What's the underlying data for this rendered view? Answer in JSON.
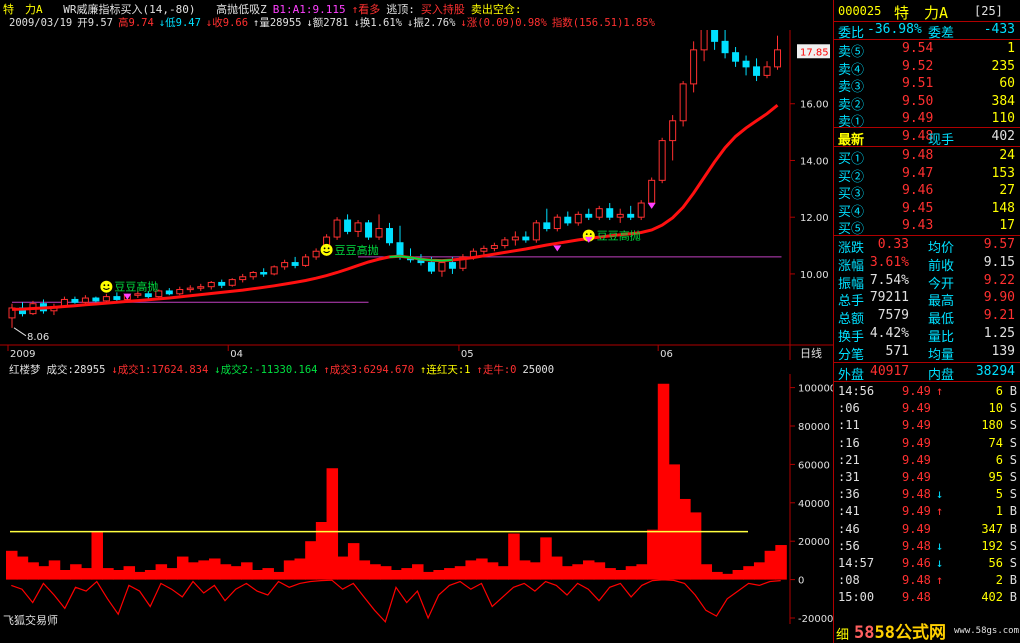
{
  "header": {
    "stock_name": "特　力A",
    "indicator_name": "WR威廉指标买入(14,-80)",
    "line1_rest": [
      {
        "text": "高抛低吸Z",
        "color": "#e0e0e0"
      },
      {
        "text": "B1:A1:9.115",
        "color": "#ff40ff"
      },
      {
        "text": "↑看多",
        "color": "#ff3030"
      },
      {
        "text": "逃顶:",
        "color": "#e0e0e0"
      },
      {
        "text": "买入持股",
        "color": "#ff3030"
      },
      {
        "text": "卖出空仓:",
        "color": "#ffff00"
      }
    ],
    "line2": [
      {
        "text": "2009/03/19",
        "color": "#e0e0e0"
      },
      {
        "text": "开9.57",
        "color": "#e0e0e0"
      },
      {
        "text": "高9.74",
        "color": "#ff3030"
      },
      {
        "text": "↓低9.47",
        "color": "#00e0ff"
      },
      {
        "text": "↓收9.66",
        "color": "#ff3030"
      },
      {
        "text": "↑量28955",
        "color": "#e0e0e0"
      },
      {
        "text": "↓额2781",
        "color": "#e0e0e0"
      },
      {
        "text": "↓换1.61%",
        "color": "#e0e0e0"
      },
      {
        "text": "↓振2.76%",
        "color": "#e0e0e0"
      },
      {
        "text": "↓涨(0.09)0.98%",
        "color": "#ff3030"
      },
      {
        "text": "指数(156.51)1.85%",
        "color": "#ff3030"
      }
    ]
  },
  "price_axis": {
    "labels": [
      "16.00",
      "14.00",
      "12.00",
      "10.00"
    ],
    "current_price_tag": "17.85",
    "min_price_label": "8.06",
    "period_label": "日线"
  },
  "date_axis": {
    "labels": [
      "2009",
      "04",
      "05",
      "06"
    ]
  },
  "annotations": {
    "smiley_label": "豆豆高抛"
  },
  "volume_header": [
    {
      "text": "红楼梦",
      "color": "#e0e0e0"
    },
    {
      "text": "成交:28955",
      "color": "#e0e0e0"
    },
    {
      "text": "↓成交1:17624.834",
      "color": "#ff3030"
    },
    {
      "text": "↓成交2:-11330.164",
      "color": "#00e040"
    },
    {
      "text": "↑成交3:6294.670",
      "color": "#ff3030"
    },
    {
      "text": "↑连红天:1",
      "color": "#ffff00"
    },
    {
      "text": "↑走牛:0",
      "color": "#ff3030"
    },
    {
      "text": "25000",
      "color": "#e0e0e0"
    }
  ],
  "volume_axis": {
    "labels": [
      "100000",
      "80000",
      "60000",
      "40000",
      "20000",
      "0",
      "-20000"
    ]
  },
  "footer": {
    "software_name": "飞狐交易师",
    "watermark": "58公式网",
    "watermark_url": "www.58gs.com",
    "bottom_tab": "细"
  },
  "quote": {
    "code": "000025",
    "name": "特　力A",
    "count": "[25]",
    "weibi_label": "委比",
    "weibi_value": "-36.98%",
    "weicha_label": "委差",
    "weicha_value": "-433",
    "sell": [
      {
        "label": "卖⑤",
        "price": "9.54",
        "vol": "1"
      },
      {
        "label": "卖④",
        "price": "9.52",
        "vol": "235"
      },
      {
        "label": "卖③",
        "price": "9.51",
        "vol": "60"
      },
      {
        "label": "卖②",
        "price": "9.50",
        "vol": "384"
      },
      {
        "label": "卖①",
        "price": "9.49",
        "vol": "110"
      }
    ],
    "latest": {
      "label": "最新",
      "price": "9.48",
      "hand_label": "现手",
      "hand": "402"
    },
    "buy": [
      {
        "label": "买①",
        "price": "9.48",
        "vol": "24"
      },
      {
        "label": "买②",
        "price": "9.47",
        "vol": "153"
      },
      {
        "label": "买③",
        "price": "9.46",
        "vol": "27"
      },
      {
        "label": "买④",
        "price": "9.45",
        "vol": "148"
      },
      {
        "label": "买⑤",
        "price": "9.43",
        "vol": "17"
      }
    ],
    "stats": [
      {
        "l1": "涨跌",
        "v1": "0.33",
        "c1": "#ff3030",
        "l2": "均价",
        "v2": "9.57",
        "c2": "#ff3030"
      },
      {
        "l1": "涨幅",
        "v1": "3.61%",
        "c1": "#ff3030",
        "l2": "前收",
        "v2": "9.15",
        "c2": "#e0e0e0"
      },
      {
        "l1": "振幅",
        "v1": "7.54%",
        "c1": "#e0e0e0",
        "l2": "今开",
        "v2": "9.22",
        "c2": "#ff3030"
      },
      {
        "l1": "总手",
        "v1": "79211",
        "c1": "#e0e0e0",
        "l2": "最高",
        "v2": "9.90",
        "c2": "#ff3030"
      },
      {
        "l1": "总额",
        "v1": "7579",
        "c1": "#e0e0e0",
        "l2": "最低",
        "v2": "9.21",
        "c2": "#ff3030"
      },
      {
        "l1": "换手",
        "v1": "4.42%",
        "c1": "#e0e0e0",
        "l2": "量比",
        "v2": "1.25",
        "c2": "#e0e0e0"
      },
      {
        "l1": "分笔",
        "v1": "571",
        "c1": "#e0e0e0",
        "l2": "均量",
        "v2": "139",
        "c2": "#e0e0e0"
      }
    ],
    "outer_label": "外盘",
    "outer_value": "40917",
    "inner_label": "内盘",
    "inner_value": "38294",
    "ticks": [
      {
        "time": "14:56",
        "price": "9.49",
        "arrow": "↑",
        "vol": "6",
        "side": "B"
      },
      {
        "time": ":06",
        "price": "9.49",
        "arrow": "",
        "vol": "10",
        "side": "S"
      },
      {
        "time": ":11",
        "price": "9.49",
        "arrow": "",
        "vol": "180",
        "side": "S"
      },
      {
        "time": ":16",
        "price": "9.49",
        "arrow": "",
        "vol": "74",
        "side": "S"
      },
      {
        "time": ":21",
        "price": "9.49",
        "arrow": "",
        "vol": "6",
        "side": "S"
      },
      {
        "time": ":31",
        "price": "9.49",
        "arrow": "",
        "vol": "95",
        "side": "S"
      },
      {
        "time": ":36",
        "price": "9.48",
        "arrow": "↓",
        "vol": "5",
        "side": "S"
      },
      {
        "time": ":41",
        "price": "9.49",
        "arrow": "↑",
        "vol": "1",
        "side": "B"
      },
      {
        "time": ":46",
        "price": "9.49",
        "arrow": "",
        "vol": "347",
        "side": "B"
      },
      {
        "time": ":56",
        "price": "9.48",
        "arrow": "↓",
        "vol": "192",
        "side": "S"
      },
      {
        "time": "14:57",
        "price": "9.46",
        "arrow": "↓",
        "vol": "56",
        "side": "S"
      },
      {
        "time": ":08",
        "price": "9.48",
        "arrow": "↑",
        "vol": "2",
        "side": "B"
      },
      {
        "time": "15:00",
        "price": "9.48",
        "arrow": "",
        "vol": "402",
        "side": "B"
      }
    ]
  },
  "colors": {
    "up": "#ff3030",
    "down": "#00e0ff",
    "label": "#ffff00",
    "ma": "#ff1010",
    "border": "#b00000",
    "refline": "#c040c0"
  },
  "chart_data": [
    {
      "type": "candlestick",
      "title": "",
      "price_axis_ticks": [
        10,
        12,
        14,
        16
      ],
      "ylim": [
        7.6,
        18.6
      ],
      "x_labels": [
        "2009",
        "04",
        "05",
        "06"
      ],
      "ohlc": [
        {
          "o": 8.45,
          "h": 8.95,
          "l": 8.1,
          "c": 8.8
        },
        {
          "o": 8.8,
          "h": 9.0,
          "l": 8.5,
          "c": 8.6
        },
        {
          "o": 8.6,
          "h": 9.05,
          "l": 8.55,
          "c": 8.95
        },
        {
          "o": 8.95,
          "h": 9.1,
          "l": 8.6,
          "c": 8.7
        },
        {
          "o": 8.7,
          "h": 8.95,
          "l": 8.55,
          "c": 8.85
        },
        {
          "o": 8.85,
          "h": 9.2,
          "l": 8.8,
          "c": 9.1
        },
        {
          "o": 9.1,
          "h": 9.2,
          "l": 8.95,
          "c": 9.0
        },
        {
          "o": 9.0,
          "h": 9.25,
          "l": 8.95,
          "c": 9.15
        },
        {
          "o": 9.15,
          "h": 9.2,
          "l": 8.95,
          "c": 9.05
        },
        {
          "o": 9.05,
          "h": 9.3,
          "l": 9.0,
          "c": 9.2
        },
        {
          "o": 9.2,
          "h": 9.35,
          "l": 9.05,
          "c": 9.1
        },
        {
          "o": 9.1,
          "h": 9.3,
          "l": 9.05,
          "c": 9.25
        },
        {
          "o": 9.25,
          "h": 9.4,
          "l": 9.15,
          "c": 9.3
        },
        {
          "o": 9.3,
          "h": 9.4,
          "l": 9.1,
          "c": 9.2
        },
        {
          "o": 9.2,
          "h": 9.45,
          "l": 9.15,
          "c": 9.4
        },
        {
          "o": 9.4,
          "h": 9.5,
          "l": 9.25,
          "c": 9.3
        },
        {
          "o": 9.3,
          "h": 9.55,
          "l": 9.25,
          "c": 9.45
        },
        {
          "o": 9.45,
          "h": 9.6,
          "l": 9.35,
          "c": 9.5
        },
        {
          "o": 9.5,
          "h": 9.65,
          "l": 9.4,
          "c": 9.55
        },
        {
          "o": 9.55,
          "h": 9.75,
          "l": 9.45,
          "c": 9.7
        },
        {
          "o": 9.7,
          "h": 9.8,
          "l": 9.5,
          "c": 9.6
        },
        {
          "o": 9.6,
          "h": 9.85,
          "l": 9.55,
          "c": 9.8
        },
        {
          "o": 9.8,
          "h": 10.0,
          "l": 9.7,
          "c": 9.9
        },
        {
          "o": 9.9,
          "h": 10.1,
          "l": 9.8,
          "c": 10.05
        },
        {
          "o": 10.05,
          "h": 10.2,
          "l": 9.9,
          "c": 10.0
        },
        {
          "o": 10.0,
          "h": 10.3,
          "l": 9.95,
          "c": 10.25
        },
        {
          "o": 10.25,
          "h": 10.5,
          "l": 10.15,
          "c": 10.4
        },
        {
          "o": 10.4,
          "h": 10.6,
          "l": 10.2,
          "c": 10.3
        },
        {
          "o": 10.3,
          "h": 10.7,
          "l": 10.25,
          "c": 10.6
        },
        {
          "o": 10.6,
          "h": 10.9,
          "l": 10.5,
          "c": 10.8
        },
        {
          "o": 10.8,
          "h": 11.4,
          "l": 10.7,
          "c": 11.3
        },
        {
          "o": 11.3,
          "h": 12.0,
          "l": 11.2,
          "c": 11.9
        },
        {
          "o": 11.9,
          "h": 12.1,
          "l": 11.4,
          "c": 11.5
        },
        {
          "o": 11.5,
          "h": 11.9,
          "l": 11.3,
          "c": 11.8
        },
        {
          "o": 11.8,
          "h": 11.9,
          "l": 11.2,
          "c": 11.3
        },
        {
          "o": 11.3,
          "h": 12.1,
          "l": 11.2,
          "c": 11.6
        },
        {
          "o": 11.6,
          "h": 11.8,
          "l": 11.0,
          "c": 11.1
        },
        {
          "o": 11.1,
          "h": 11.7,
          "l": 10.5,
          "c": 10.6
        },
        {
          "o": 10.6,
          "h": 10.9,
          "l": 10.4,
          "c": 10.5
        },
        {
          "o": 10.5,
          "h": 10.7,
          "l": 10.3,
          "c": 10.4
        },
        {
          "o": 10.4,
          "h": 10.6,
          "l": 10.0,
          "c": 10.1
        },
        {
          "o": 10.1,
          "h": 10.5,
          "l": 9.9,
          "c": 10.4
        },
        {
          "o": 10.4,
          "h": 10.6,
          "l": 10.0,
          "c": 10.2
        },
        {
          "o": 10.2,
          "h": 10.7,
          "l": 10.1,
          "c": 10.6
        },
        {
          "o": 10.6,
          "h": 10.9,
          "l": 10.5,
          "c": 10.8
        },
        {
          "o": 10.8,
          "h": 11.0,
          "l": 10.6,
          "c": 10.9
        },
        {
          "o": 10.9,
          "h": 11.1,
          "l": 10.8,
          "c": 11.0
        },
        {
          "o": 11.0,
          "h": 11.3,
          "l": 10.9,
          "c": 11.2
        },
        {
          "o": 11.2,
          "h": 11.5,
          "l": 11.0,
          "c": 11.3
        },
        {
          "o": 11.3,
          "h": 11.5,
          "l": 11.1,
          "c": 11.2
        },
        {
          "o": 11.2,
          "h": 11.9,
          "l": 11.1,
          "c": 11.8
        },
        {
          "o": 11.8,
          "h": 12.3,
          "l": 11.5,
          "c": 11.6
        },
        {
          "o": 11.6,
          "h": 12.1,
          "l": 11.5,
          "c": 12.0
        },
        {
          "o": 12.0,
          "h": 12.2,
          "l": 11.7,
          "c": 11.8
        },
        {
          "o": 11.8,
          "h": 12.2,
          "l": 11.7,
          "c": 12.1
        },
        {
          "o": 12.1,
          "h": 12.3,
          "l": 11.9,
          "c": 12.0
        },
        {
          "o": 12.0,
          "h": 12.4,
          "l": 11.9,
          "c": 12.3
        },
        {
          "o": 12.3,
          "h": 12.5,
          "l": 11.9,
          "c": 12.0
        },
        {
          "o": 12.0,
          "h": 12.3,
          "l": 11.8,
          "c": 12.1
        },
        {
          "o": 12.1,
          "h": 12.4,
          "l": 11.9,
          "c": 12.0
        },
        {
          "o": 12.0,
          "h": 12.6,
          "l": 11.9,
          "c": 12.5
        },
        {
          "o": 12.5,
          "h": 13.4,
          "l": 12.4,
          "c": 13.3
        },
        {
          "o": 13.3,
          "h": 14.8,
          "l": 13.2,
          "c": 14.7
        },
        {
          "o": 14.7,
          "h": 15.6,
          "l": 14.0,
          "c": 15.4
        },
        {
          "o": 15.4,
          "h": 16.8,
          "l": 15.2,
          "c": 16.7
        },
        {
          "o": 16.7,
          "h": 18.2,
          "l": 16.4,
          "c": 17.9
        },
        {
          "o": 17.9,
          "h": 19.3,
          "l": 17.5,
          "c": 18.9
        },
        {
          "o": 18.9,
          "h": 19.2,
          "l": 17.9,
          "c": 18.2
        },
        {
          "o": 18.2,
          "h": 18.6,
          "l": 17.6,
          "c": 17.8
        },
        {
          "o": 17.8,
          "h": 18.0,
          "l": 17.3,
          "c": 17.5
        },
        {
          "o": 17.5,
          "h": 17.7,
          "l": 17.0,
          "c": 17.3
        },
        {
          "o": 17.3,
          "h": 17.6,
          "l": 16.8,
          "c": 17.0
        },
        {
          "o": 17.0,
          "h": 17.5,
          "l": 16.9,
          "c": 17.3
        },
        {
          "o": 17.3,
          "h": 18.4,
          "l": 17.2,
          "c": 17.9
        }
      ],
      "ma_line": [
        8.75,
        8.76,
        8.78,
        8.8,
        8.82,
        8.85,
        8.88,
        8.91,
        8.94,
        8.97,
        9.0,
        9.03,
        9.06,
        9.09,
        9.12,
        9.15,
        9.19,
        9.23,
        9.27,
        9.31,
        9.35,
        9.39,
        9.43,
        9.48,
        9.53,
        9.58,
        9.64,
        9.7,
        9.77,
        9.85,
        9.94,
        10.05,
        10.17,
        10.3,
        10.42,
        10.52,
        10.6,
        10.62,
        10.58,
        10.52,
        10.48,
        10.47,
        10.49,
        10.53,
        10.58,
        10.64,
        10.7,
        10.76,
        10.82,
        10.88,
        10.95,
        11.02,
        11.08,
        11.14,
        11.2,
        11.25,
        11.3,
        11.34,
        11.38,
        11.42,
        11.46,
        11.55,
        11.72,
        11.98,
        12.35,
        12.85,
        13.4,
        13.95,
        14.45,
        14.85,
        15.15,
        15.4,
        15.65,
        15.95
      ],
      "reference_lines": [
        9.0,
        10.6
      ]
    },
    {
      "type": "bar",
      "title": "",
      "ylim": [
        -20000,
        105000
      ],
      "y_ticks": [
        100000,
        80000,
        60000,
        40000,
        20000,
        0,
        -20000
      ],
      "threshold": 25000,
      "volume_bars": [
        15000,
        12000,
        9000,
        7000,
        10000,
        5000,
        8000,
        6000,
        25000,
        6000,
        5000,
        7000,
        4000,
        5000,
        8000,
        6000,
        12000,
        9000,
        10000,
        11000,
        8000,
        7000,
        9000,
        5000,
        6000,
        4000,
        10000,
        11000,
        20000,
        30000,
        58000,
        12000,
        19000,
        10000,
        8000,
        7000,
        5000,
        6000,
        8000,
        4000,
        5000,
        6000,
        7000,
        10000,
        11000,
        9000,
        7000,
        24000,
        10000,
        9000,
        22000,
        12000,
        7000,
        8000,
        10000,
        9000,
        6000,
        5000,
        7000,
        8000,
        26000,
        102000,
        60000,
        42000,
        35000,
        8000,
        4000,
        3000,
        5000,
        7000,
        9000,
        15000,
        18000
      ],
      "oscillator": [
        -3000,
        -5000,
        -12000,
        -2000,
        -8000,
        -15000,
        -4000,
        -6000,
        -1000,
        -10000,
        -18000,
        -3000,
        -6000,
        -14000,
        -2000,
        -5000,
        -9000,
        -1000,
        -7000,
        -3000,
        -11000,
        -5000,
        -2000,
        -6000,
        -8000,
        -1000,
        -4000,
        -2000,
        -1000,
        -500,
        -300,
        -5000,
        -2000,
        -9000,
        -16000,
        -22000,
        -4000,
        -12000,
        -6000,
        -20000,
        -8000,
        -3000,
        -1000,
        -5000,
        -2000,
        -14000,
        -9000,
        -4000,
        -2000,
        -6000,
        -1000,
        -3000,
        -8000,
        -2000,
        -5000,
        -11000,
        -4000,
        -2000,
        -9000,
        -3000,
        -500,
        -100,
        -400,
        -2000,
        -8000,
        -16000,
        -19000,
        -10000,
        -6000,
        -2000,
        -3000,
        -1000,
        -500
      ]
    }
  ]
}
